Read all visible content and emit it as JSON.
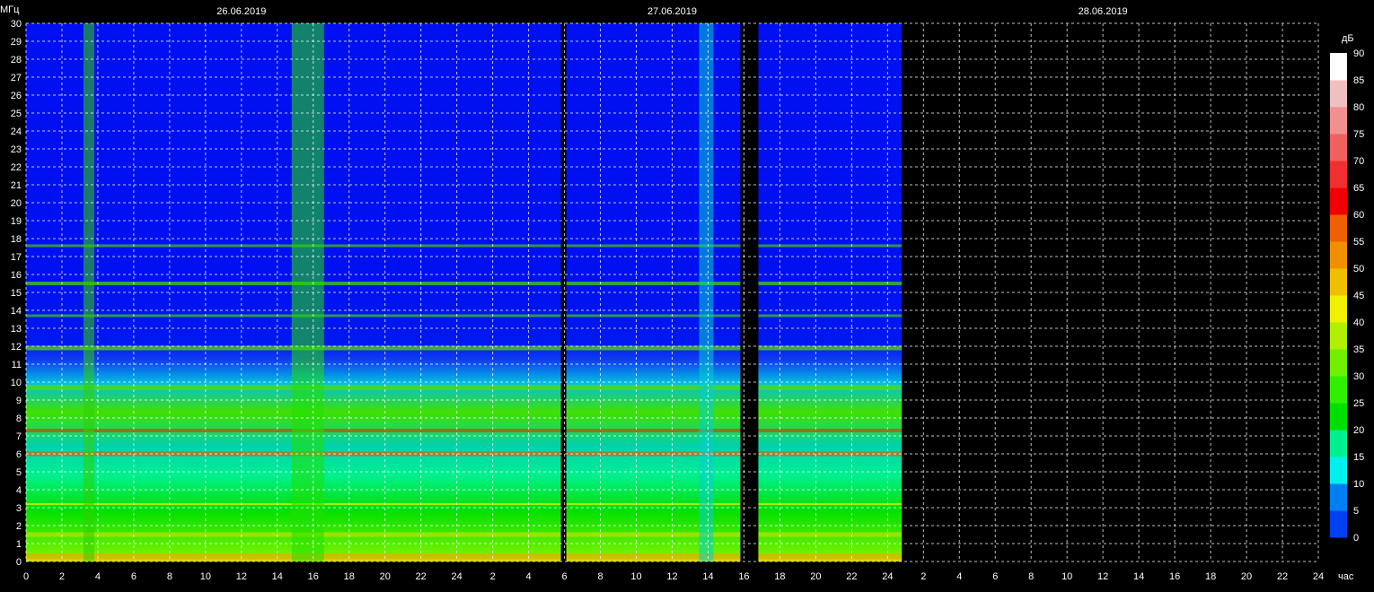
{
  "chart_data": {
    "type": "heatmap",
    "title": "",
    "ylabel": "МГц",
    "xlabel": "час",
    "colorbar_label": "дБ",
    "ylim": [
      0,
      30
    ],
    "yticks": [
      "0",
      "1",
      "2",
      "3",
      "4",
      "5",
      "6",
      "7",
      "8",
      "9",
      "10",
      "11",
      "12",
      "13",
      "14",
      "15",
      "16",
      "17",
      "18",
      "19",
      "20",
      "21",
      "22",
      "23",
      "24",
      "25",
      "26",
      "27",
      "28",
      "29",
      "30"
    ],
    "xticks": [
      "0",
      "2",
      "4",
      "6",
      "8",
      "10",
      "12",
      "14",
      "16",
      "18",
      "20",
      "22",
      "24",
      "2",
      "4",
      "6",
      "8",
      "10",
      "12",
      "14",
      "16",
      "18",
      "20",
      "22",
      "24",
      "2",
      "4",
      "6",
      "8",
      "10",
      "12",
      "14",
      "16",
      "18",
      "20",
      "22",
      "24"
    ],
    "dates": [
      "26.06.2019",
      "27.06.2019",
      "28.06.2019"
    ],
    "time_range_hours": [
      0,
      72
    ],
    "data_end_hour": 48.8,
    "gaps_hours": [
      [
        29.8,
        30.1
      ],
      [
        39.8,
        40.8
      ]
    ],
    "grid": true,
    "colorbar": {
      "ticks": [
        "0",
        "5",
        "10",
        "15",
        "20",
        "25",
        "30",
        "35",
        "40",
        "45",
        "50",
        "55",
        "60",
        "65",
        "70",
        "75",
        "80",
        "85",
        "90"
      ],
      "colors": [
        "#0010f0",
        "#0040f0",
        "#0080f0",
        "#00f0f0",
        "#00f090",
        "#00e000",
        "#30f000",
        "#70f000",
        "#b0f000",
        "#f0f000",
        "#f0c000",
        "#f09000",
        "#f06000",
        "#f00000",
        "#f03030",
        "#f06060",
        "#f09090",
        "#f0c0c0",
        "#ffffff"
      ]
    }
  }
}
